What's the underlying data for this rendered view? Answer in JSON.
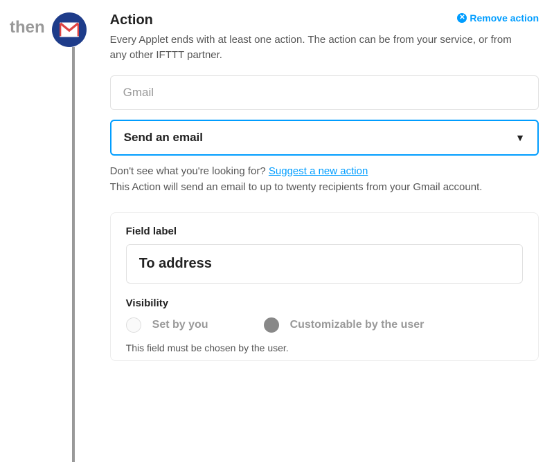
{
  "left": {
    "then_label": "then",
    "service": "gmail"
  },
  "header": {
    "title": "Action",
    "remove_label": "Remove action"
  },
  "description": "Every Applet ends with at least one action. The action can be from your service, or from any other IFTTT partner.",
  "service_input": {
    "placeholder": "Gmail"
  },
  "action_select": {
    "selected": "Send an email"
  },
  "suggest": {
    "prefix": "Don't see what you're looking for?  ",
    "link": "Suggest a new action"
  },
  "action_description": "This Action will send an email to up to twenty recipients from your Gmail account.",
  "field": {
    "label_title": "Field label",
    "label_value": "To address",
    "visibility_title": "Visibility",
    "options": {
      "set_by_you": "Set by you",
      "customizable": "Customizable by the user"
    },
    "hint": "This field must be chosen by the user."
  }
}
